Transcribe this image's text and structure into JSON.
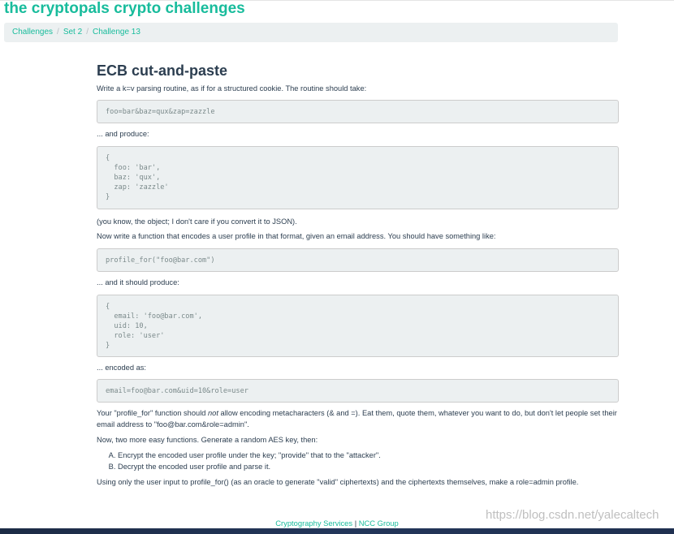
{
  "site": {
    "title": "the cryptopals crypto challenges"
  },
  "breadcrumb": {
    "items": [
      "Challenges",
      "Set 2",
      "Challenge 13"
    ],
    "separator": "/"
  },
  "challenge": {
    "title": "ECB cut-and-paste",
    "p1": "Write a k=v parsing routine, as if for a structured cookie. The routine should take:",
    "code1": "foo=bar&baz=qux&zap=zazzle",
    "p2": "... and produce:",
    "code2": "{\n  foo: 'bar',\n  baz: 'qux',\n  zap: 'zazzle'\n}",
    "p3": "(you know, the object; I don't care if you convert it to JSON).",
    "p4": "Now write a function that encodes a user profile in that format, given an email address. You should have something like:",
    "code3": "profile_for(\"foo@bar.com\")",
    "p5": "... and it should produce:",
    "code4": "{\n  email: 'foo@bar.com',\n  uid: 10,\n  role: 'user'\n}",
    "p6": "... encoded as:",
    "code5": "email=foo@bar.com&uid=10&role=user",
    "p7_pre": "Your \"profile_for\" function should ",
    "p7_em": "not",
    "p7_post": " allow encoding metacharacters (& and =). Eat them, quote them, whatever you want to do, but don't let people set their email address to \"foo@bar.com&role=admin\".",
    "p8": "Now, two more easy functions. Generate a random AES key, then:",
    "list": [
      "Encrypt the encoded user profile under the key; \"provide\" that to the \"attacker\".",
      "Decrypt the encoded user profile and parse it."
    ],
    "p9": "Using only the user input to profile_for() (as an oracle to generate \"valid\" ciphertexts) and the ciphertexts themselves, make a role=admin profile."
  },
  "footer": {
    "left": "Cryptography Services",
    "separator": "|",
    "right": "NCC Group"
  },
  "watermark": "https://blog.csdn.net/yalecaltech",
  "colors": {
    "accent": "#18bc9c",
    "heading": "#2c3e50",
    "code_bg": "#ecf0f1",
    "code_text": "#7b8a8b"
  }
}
